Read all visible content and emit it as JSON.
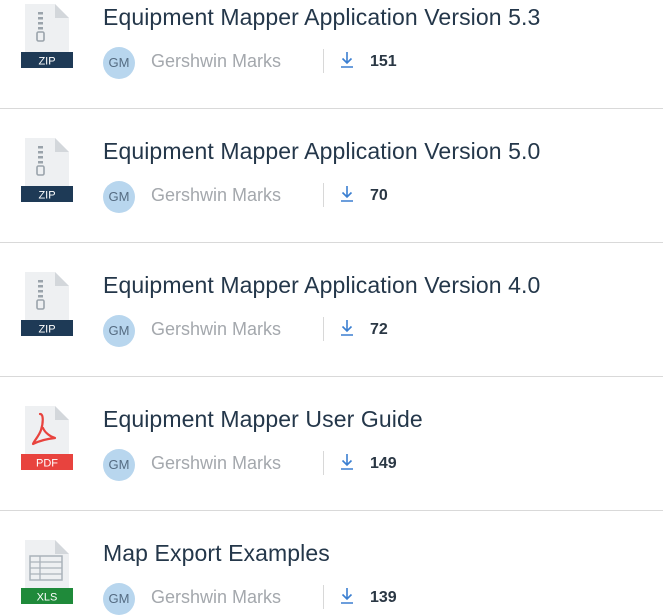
{
  "colors": {
    "zip": "#1e3a56",
    "pdf": "#e8433e",
    "xls": "#1f8a3a",
    "download_icon": "#3b7fd1"
  },
  "files": [
    {
      "title": "Equipment Mapper Application Version 5.3",
      "type": "ZIP",
      "icon": "zip-file-icon",
      "avatar": "GM",
      "author": "Gershwin Marks",
      "downloads": "151"
    },
    {
      "title": "Equipment Mapper Application Version 5.0",
      "type": "ZIP",
      "icon": "zip-file-icon",
      "avatar": "GM",
      "author": "Gershwin Marks",
      "downloads": "70"
    },
    {
      "title": "Equipment Mapper Application Version 4.0",
      "type": "ZIP",
      "icon": "zip-file-icon",
      "avatar": "GM",
      "author": "Gershwin Marks",
      "downloads": "72"
    },
    {
      "title": "Equipment Mapper User Guide",
      "type": "PDF",
      "icon": "pdf-file-icon",
      "avatar": "GM",
      "author": "Gershwin Marks",
      "downloads": "149"
    },
    {
      "title": "Map Export Examples",
      "type": "XLS",
      "icon": "xls-file-icon",
      "avatar": "GM",
      "author": "Gershwin Marks",
      "downloads": "139"
    }
  ]
}
